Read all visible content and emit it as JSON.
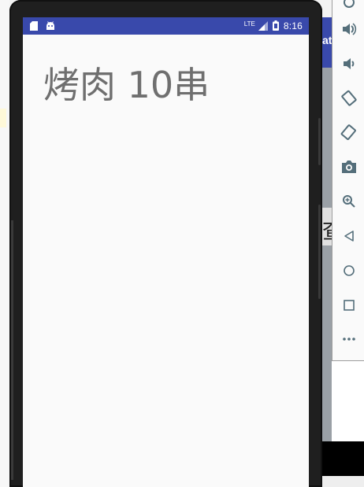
{
  "status_bar": {
    "time": "8:16",
    "signal_label": "LTE",
    "icons": [
      "sd-card-icon",
      "android-icon",
      "signal-icon",
      "battery-icon"
    ]
  },
  "app": {
    "main_text": "烤肉 10串"
  },
  "background_window": {
    "title_fragment": "at",
    "content_fragment": "查"
  },
  "emulator_toolbar": {
    "buttons": [
      "volume-up-icon",
      "volume-down-icon",
      "rotate-left-icon",
      "rotate-right-icon",
      "camera-icon",
      "zoom-in-icon",
      "back-icon",
      "home-icon",
      "overview-icon",
      "more-icon"
    ]
  },
  "colors": {
    "status_bar": "#3949ab",
    "screen_background": "#fafafa",
    "text": "#6f6f6f",
    "toolbar_icons": "#546e7a"
  }
}
